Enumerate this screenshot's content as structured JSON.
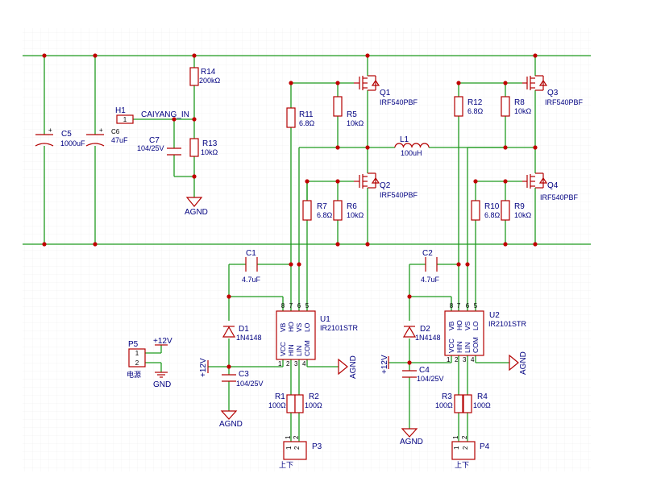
{
  "nets": {
    "caiyang_in": "CAIYANG_IN",
    "agnd": "AGND",
    "gnd": "GND",
    "p12v": "+12V"
  },
  "components": {
    "C5": {
      "ref": "C5",
      "value": "1000uF"
    },
    "C6": {
      "ref": "C6",
      "value": "47uF"
    },
    "C7": {
      "ref": "C7",
      "value": "104/25V"
    },
    "H1": {
      "ref": "H1",
      "pin": "1"
    },
    "R14": {
      "ref": "R14",
      "value": "200kΩ"
    },
    "R13": {
      "ref": "R13",
      "value": "10kΩ"
    },
    "R11": {
      "ref": "R11",
      "value": "6.8Ω"
    },
    "R5": {
      "ref": "R5",
      "value": "10kΩ"
    },
    "Q1": {
      "ref": "Q1",
      "value": "IRF540PBF"
    },
    "Q2": {
      "ref": "Q2",
      "value": "IRF540PBF"
    },
    "R7": {
      "ref": "R7",
      "value": "6.8Ω"
    },
    "R6": {
      "ref": "R6",
      "value": "10kΩ"
    },
    "L1": {
      "ref": "L1",
      "value": "100uH"
    },
    "R12": {
      "ref": "R12",
      "value": "6.8Ω"
    },
    "R8": {
      "ref": "R8",
      "value": "10kΩ"
    },
    "Q3": {
      "ref": "Q3",
      "value": "IRF540PBF"
    },
    "Q4": {
      "ref": "Q4",
      "value": "IRF540PBF"
    },
    "R10": {
      "ref": "R10",
      "value": "6.8Ω"
    },
    "R9": {
      "ref": "R9",
      "value": "10kΩ"
    },
    "C1": {
      "ref": "C1",
      "value": "4.7uF"
    },
    "C2": {
      "ref": "C2",
      "value": "4.7uF"
    },
    "U1": {
      "ref": "U1",
      "value": "IR2101STR"
    },
    "U2": {
      "ref": "U2",
      "value": "IR2101STR"
    },
    "D1": {
      "ref": "D1",
      "value": "1N4148"
    },
    "D2": {
      "ref": "D2",
      "value": "1N4148"
    },
    "C3": {
      "ref": "C3",
      "value": "104/25V"
    },
    "C4": {
      "ref": "C4",
      "value": "104/25V"
    },
    "R1": {
      "ref": "R1",
      "value": "100Ω"
    },
    "R2": {
      "ref": "R2",
      "value": "100Ω"
    },
    "R3": {
      "ref": "R3",
      "value": "100Ω"
    },
    "R4": {
      "ref": "R4",
      "value": "100Ω"
    },
    "P3": {
      "ref": "P3",
      "label": "上下"
    },
    "P4": {
      "ref": "P4",
      "label": "上下"
    },
    "P5": {
      "ref": "P5",
      "label": "电源"
    }
  },
  "ic_pins": {
    "top": [
      "VB",
      "HO",
      "VS",
      "LO"
    ],
    "top_nums": [
      "8",
      "7",
      "6",
      "5"
    ],
    "bottom": [
      "VCC",
      "HIN",
      "LIN",
      "COM"
    ],
    "bottom_nums": [
      "1",
      "2",
      "3",
      "4"
    ]
  },
  "connector_pins": [
    "1",
    "2"
  ]
}
